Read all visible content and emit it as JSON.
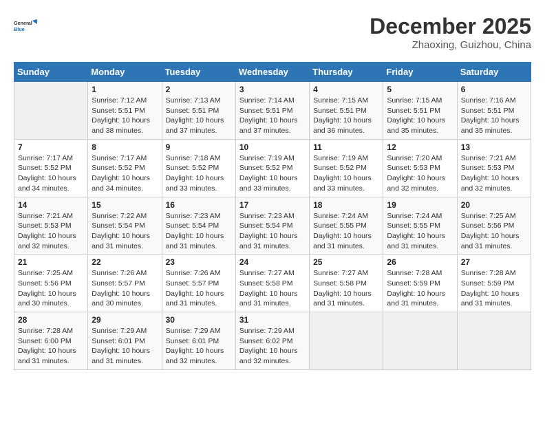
{
  "logo": {
    "line1": "General",
    "line2": "Blue"
  },
  "title": "December 2025",
  "location": "Zhaoxing, Guizhou, China",
  "days_header": [
    "Sunday",
    "Monday",
    "Tuesday",
    "Wednesday",
    "Thursday",
    "Friday",
    "Saturday"
  ],
  "weeks": [
    [
      {
        "num": "",
        "info": ""
      },
      {
        "num": "1",
        "info": "Sunrise: 7:12 AM\nSunset: 5:51 PM\nDaylight: 10 hours\nand 38 minutes."
      },
      {
        "num": "2",
        "info": "Sunrise: 7:13 AM\nSunset: 5:51 PM\nDaylight: 10 hours\nand 37 minutes."
      },
      {
        "num": "3",
        "info": "Sunrise: 7:14 AM\nSunset: 5:51 PM\nDaylight: 10 hours\nand 37 minutes."
      },
      {
        "num": "4",
        "info": "Sunrise: 7:15 AM\nSunset: 5:51 PM\nDaylight: 10 hours\nand 36 minutes."
      },
      {
        "num": "5",
        "info": "Sunrise: 7:15 AM\nSunset: 5:51 PM\nDaylight: 10 hours\nand 35 minutes."
      },
      {
        "num": "6",
        "info": "Sunrise: 7:16 AM\nSunset: 5:51 PM\nDaylight: 10 hours\nand 35 minutes."
      }
    ],
    [
      {
        "num": "7",
        "info": "Sunrise: 7:17 AM\nSunset: 5:52 PM\nDaylight: 10 hours\nand 34 minutes."
      },
      {
        "num": "8",
        "info": "Sunrise: 7:17 AM\nSunset: 5:52 PM\nDaylight: 10 hours\nand 34 minutes."
      },
      {
        "num": "9",
        "info": "Sunrise: 7:18 AM\nSunset: 5:52 PM\nDaylight: 10 hours\nand 33 minutes."
      },
      {
        "num": "10",
        "info": "Sunrise: 7:19 AM\nSunset: 5:52 PM\nDaylight: 10 hours\nand 33 minutes."
      },
      {
        "num": "11",
        "info": "Sunrise: 7:19 AM\nSunset: 5:52 PM\nDaylight: 10 hours\nand 33 minutes."
      },
      {
        "num": "12",
        "info": "Sunrise: 7:20 AM\nSunset: 5:53 PM\nDaylight: 10 hours\nand 32 minutes."
      },
      {
        "num": "13",
        "info": "Sunrise: 7:21 AM\nSunset: 5:53 PM\nDaylight: 10 hours\nand 32 minutes."
      }
    ],
    [
      {
        "num": "14",
        "info": "Sunrise: 7:21 AM\nSunset: 5:53 PM\nDaylight: 10 hours\nand 32 minutes."
      },
      {
        "num": "15",
        "info": "Sunrise: 7:22 AM\nSunset: 5:54 PM\nDaylight: 10 hours\nand 31 minutes."
      },
      {
        "num": "16",
        "info": "Sunrise: 7:23 AM\nSunset: 5:54 PM\nDaylight: 10 hours\nand 31 minutes."
      },
      {
        "num": "17",
        "info": "Sunrise: 7:23 AM\nSunset: 5:54 PM\nDaylight: 10 hours\nand 31 minutes."
      },
      {
        "num": "18",
        "info": "Sunrise: 7:24 AM\nSunset: 5:55 PM\nDaylight: 10 hours\nand 31 minutes."
      },
      {
        "num": "19",
        "info": "Sunrise: 7:24 AM\nSunset: 5:55 PM\nDaylight: 10 hours\nand 31 minutes."
      },
      {
        "num": "20",
        "info": "Sunrise: 7:25 AM\nSunset: 5:56 PM\nDaylight: 10 hours\nand 31 minutes."
      }
    ],
    [
      {
        "num": "21",
        "info": "Sunrise: 7:25 AM\nSunset: 5:56 PM\nDaylight: 10 hours\nand 30 minutes."
      },
      {
        "num": "22",
        "info": "Sunrise: 7:26 AM\nSunset: 5:57 PM\nDaylight: 10 hours\nand 30 minutes."
      },
      {
        "num": "23",
        "info": "Sunrise: 7:26 AM\nSunset: 5:57 PM\nDaylight: 10 hours\nand 31 minutes."
      },
      {
        "num": "24",
        "info": "Sunrise: 7:27 AM\nSunset: 5:58 PM\nDaylight: 10 hours\nand 31 minutes."
      },
      {
        "num": "25",
        "info": "Sunrise: 7:27 AM\nSunset: 5:58 PM\nDaylight: 10 hours\nand 31 minutes."
      },
      {
        "num": "26",
        "info": "Sunrise: 7:28 AM\nSunset: 5:59 PM\nDaylight: 10 hours\nand 31 minutes."
      },
      {
        "num": "27",
        "info": "Sunrise: 7:28 AM\nSunset: 5:59 PM\nDaylight: 10 hours\nand 31 minutes."
      }
    ],
    [
      {
        "num": "28",
        "info": "Sunrise: 7:28 AM\nSunset: 6:00 PM\nDaylight: 10 hours\nand 31 minutes."
      },
      {
        "num": "29",
        "info": "Sunrise: 7:29 AM\nSunset: 6:01 PM\nDaylight: 10 hours\nand 31 minutes."
      },
      {
        "num": "30",
        "info": "Sunrise: 7:29 AM\nSunset: 6:01 PM\nDaylight: 10 hours\nand 32 minutes."
      },
      {
        "num": "31",
        "info": "Sunrise: 7:29 AM\nSunset: 6:02 PM\nDaylight: 10 hours\nand 32 minutes."
      },
      {
        "num": "",
        "info": ""
      },
      {
        "num": "",
        "info": ""
      },
      {
        "num": "",
        "info": ""
      }
    ]
  ]
}
